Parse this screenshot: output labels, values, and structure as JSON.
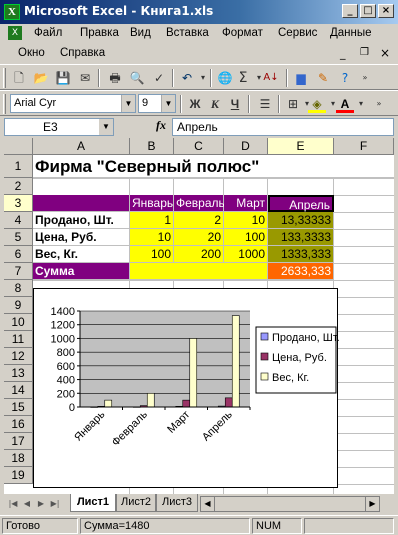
{
  "window": {
    "title": "Microsoft Excel - Книга1.xls",
    "app_icon_letter": "X"
  },
  "menu": {
    "row1": [
      "Файл",
      "Правка",
      "Вид",
      "Вставка",
      "Формат",
      "Сервис",
      "Данные"
    ],
    "row2": [
      "Окно",
      "Справка"
    ]
  },
  "format_toolbar": {
    "font": "Arial Cyr",
    "size": "9",
    "bold": "Ж",
    "italic": "К",
    "underline": "Ч"
  },
  "formula_bar": {
    "name_box": "E3",
    "fx": "fx",
    "content": "Апрель"
  },
  "grid": {
    "columns": [
      "A",
      "B",
      "C",
      "D",
      "E",
      "F"
    ],
    "rows": [
      "1",
      "2",
      "3",
      "4",
      "5",
      "6",
      "7",
      "8",
      "9",
      "10",
      "11",
      "12",
      "13",
      "14",
      "15",
      "16",
      "17",
      "18",
      "19"
    ],
    "title": "Фирма \"Северный полюс\"",
    "header_row": [
      "",
      "Январь",
      "Февраль",
      "Март",
      "Апрель"
    ],
    "data_rows": [
      [
        "Продано, Шт.",
        "1",
        "2",
        "10",
        "13,33333"
      ],
      [
        "Цена, Руб.",
        "10",
        "20",
        "100",
        "133,3333"
      ],
      [
        "Вес, Кг.",
        "100",
        "200",
        "1000",
        "1333,333"
      ]
    ],
    "sum_row": {
      "label": "Сумма",
      "value": "2633,333"
    }
  },
  "chart_data": {
    "type": "bar",
    "categories": [
      "Январь",
      "Февраль",
      "Март",
      "Апрель"
    ],
    "series": [
      {
        "name": "Продано, Шт.",
        "values": [
          1,
          2,
          10,
          13.33333
        ],
        "color": "#9999ff"
      },
      {
        "name": "Цена, Руб.",
        "values": [
          10,
          20,
          100,
          133.3333
        ],
        "color": "#993366"
      },
      {
        "name": "Вес, Кг.",
        "values": [
          100,
          200,
          1000,
          1333.333
        ],
        "color": "#ffffcc"
      }
    ],
    "yticks": [
      "1400",
      "1200",
      "1000",
      "800",
      "600",
      "400",
      "200",
      "0"
    ],
    "ylim": [
      0,
      1400
    ],
    "grid": true,
    "legend": "right"
  },
  "sheet_tabs": [
    "Лист1",
    "Лист2",
    "Лист3"
  ],
  "status": {
    "ready": "Готово",
    "sum": "Сумма=1480",
    "num": "NUM"
  }
}
